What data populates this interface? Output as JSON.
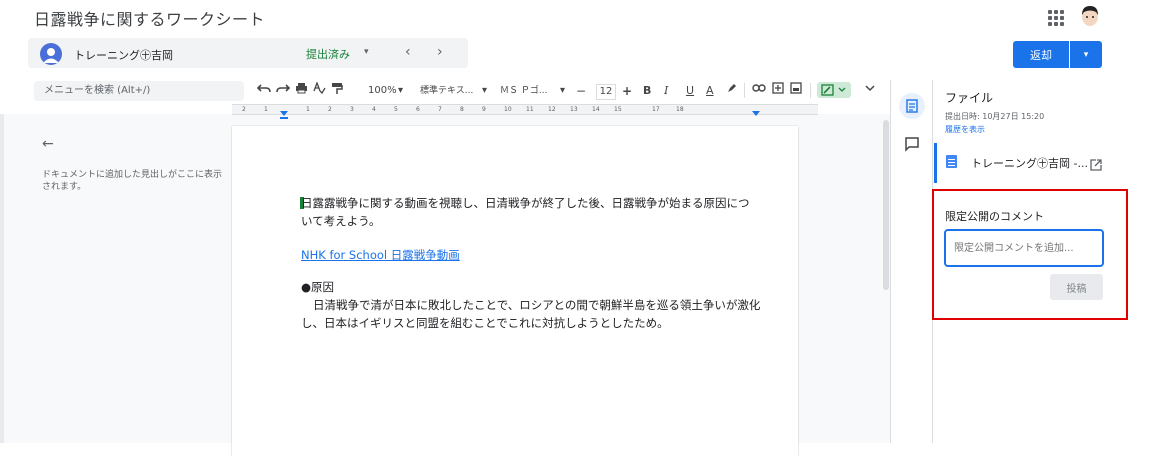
{
  "app": {
    "title": "日露戦争に関するワークシート"
  },
  "student_bar": {
    "name": "トレーニング㊉吉岡",
    "status": "提出済み",
    "status_caret": "▾",
    "prev": "‹",
    "next": "›"
  },
  "actions": {
    "return_label": "返却",
    "return_caret": "▾"
  },
  "toolbar": {
    "menu_search_placeholder": "メニューを検索 (Alt+/)",
    "zoom": "100%",
    "zoom_caret": "▾",
    "style": "標準テキス...",
    "style_caret": "▾",
    "font": "ＭＳ Ｐゴ...",
    "font_caret": "▾",
    "font_size": "12",
    "minus": "−",
    "plus": "+",
    "bold": "B",
    "italic": "I",
    "underline": "U",
    "text_color": "A"
  },
  "ruler": {
    "ticks": [
      "2",
      "1",
      "1",
      "2",
      "3",
      "4",
      "5",
      "6",
      "7",
      "8",
      "9",
      "10",
      "11",
      "12",
      "13",
      "14",
      "15",
      "17",
      "18"
    ]
  },
  "outline": {
    "back": "←",
    "empty_text": "ドキュメントに追加した見出しがここに表示されます。"
  },
  "document": {
    "para1": "日露露戦争に関する動画を視聴し、日清戦争が終了した後、日露戦争が始まる原因について考えよう。",
    "link": "NHK for School 日露戦争動画",
    "cause_title": "●原因",
    "cause_body": "日清戦争で清が日本に敗北したことで、ロシアとの間で朝鮮半島を巡る領土争いが激化し、日本はイギリスと同盟を組むことでこれに対抗しようとしたため。"
  },
  "files_panel": {
    "heading": "ファイル",
    "submitted": "提出日時: 10月27日 15:20",
    "history_link": "履歴を表示",
    "file_name": "トレーニング㊉吉岡 -..."
  },
  "private_comment": {
    "heading": "限定公開のコメント",
    "placeholder": "限定公開コメントを追加...",
    "post_label": "投稿"
  },
  "colors": {
    "accent": "#1a73e8",
    "status": "#188038",
    "highlight_box": "#e00000"
  }
}
